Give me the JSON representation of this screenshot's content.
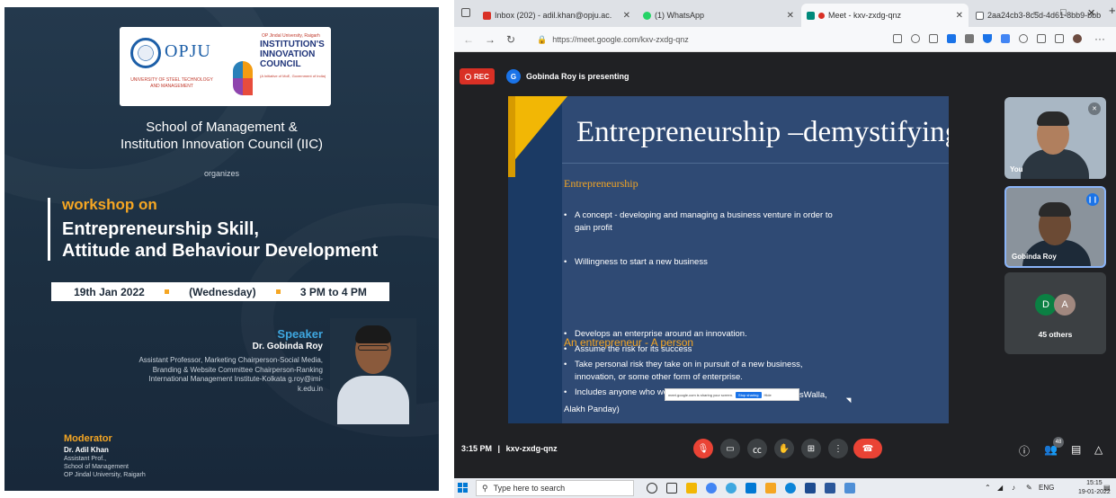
{
  "poster": {
    "opju_logo_text": "OPJU",
    "opju_subtext": "UNIVERSITY OF STEEL TECHNOLOGY AND MANAGEMENT",
    "iic_top": "OP Jindal University, Raigarh",
    "iic_title": "INSTITUTION'S INNOVATION COUNCIL",
    "iic_sub": "(A Initiative of MoE, Government of India)",
    "school_line1": "School of Management &",
    "school_line2": "Institution Innovation Council (IIC)",
    "organizes": "organizes",
    "workshop_label": "workshop on",
    "title_line1": "Entrepreneurship Skill,",
    "title_line2": "Attitude and Behaviour Development",
    "date": "19th Jan 2022",
    "day": "(Wednesday)",
    "time": "3 PM to 4 PM",
    "speaker_heading": "Speaker",
    "speaker_name": "Dr. Gobinda Roy",
    "speaker_desc": "Assistant Professor, Marketing Chairperson-Social Media, Branding & Website Committee Chairperson-Ranking International Management Institute-Kolkata g.roy@imi-k.edu.in",
    "moderator_heading": "Moderator",
    "moderator_name": "Dr. Adil Khan",
    "moderator_desc1": "Assistant Prof.,",
    "moderator_desc2": "School of Management",
    "moderator_desc3": "OP Jindal University, Raigarh"
  },
  "browser": {
    "tabs": [
      {
        "label": "Inbox (202) - adil.khan@opju.ac.",
        "color": "#d93025"
      },
      {
        "label": "(1) WhatsApp",
        "color": "#25d366"
      },
      {
        "label": "Meet - kxv-zxdg-qnz",
        "color": "#00897b"
      },
      {
        "label": "2aa24cb3-8c5d-4d61-8bb9-bbb",
        "color": "#5f6368"
      }
    ],
    "new_tab": "+",
    "win_min": "–",
    "win_max": "□",
    "win_close": "✕",
    "url": "https://meet.google.com/kxv-zxdg-qnz",
    "more": "···"
  },
  "meet": {
    "rec": "REC",
    "presenter_initial": "G",
    "presenting": "Gobinda Roy is presenting",
    "slide": {
      "title": "Entrepreneurship –demystifying",
      "heading1": "Entrepreneurship",
      "bullets1": [
        "A concept - developing and managing a business venture in order to gain profit",
        "Willingness to start a new business"
      ],
      "heading2": "An entrepreneur  - A person",
      "bullets2": [
        "Develops an enterprise around an innovation.",
        "Assume the risk for its success",
        "Take personal risk they take on in pursuit of a new business, innovation, or some other form of enterprise.",
        "Includes anyone who wo"
      ],
      "share_msg": "meet.google.com is sharing your screen.",
      "stop_label": "Stop sharing",
      "hide_label": "Hide",
      "tail1": "sWalla,",
      "tail2": "Alakh Panday)"
    },
    "tiles": {
      "you": "You",
      "gobinda": "Gobinda Roy",
      "avatar_d": "D",
      "avatar_a": "A",
      "others": "45 others"
    },
    "time": "3:15 PM",
    "sep": "|",
    "code": "kxv-zxdg-qnz",
    "people_badge": "48"
  },
  "taskbar": {
    "search_placeholder": "Type here to search",
    "lang": "ENG",
    "clock_time": "15:15",
    "clock_date": "19-01-2022"
  },
  "colors": {
    "poster_bg": "#1c2f41",
    "accent_orange": "#f5a623",
    "speaker_blue": "#3ea7e0",
    "meet_bg": "#202124",
    "slide_bg": "#2f4a74",
    "end_call_red": "#ea4335"
  }
}
